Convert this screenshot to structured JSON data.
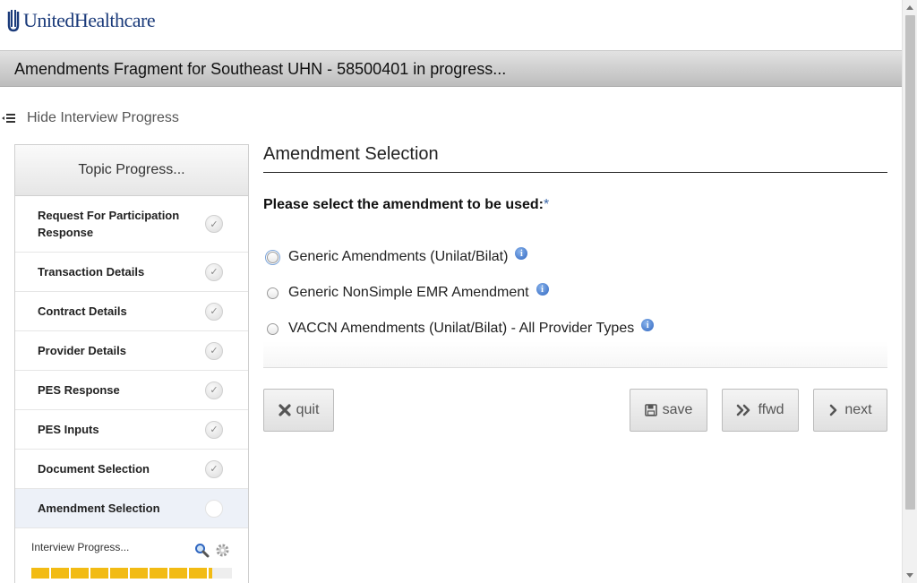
{
  "brand": {
    "logo_text": "UnitedHealthcare"
  },
  "header": {
    "title": "Amendments Fragment for Southeast UHN - 58500401 in progress..."
  },
  "sidebar_toggle": {
    "label": "Hide Interview Progress",
    "icon": "hamburger-collapse-icon"
  },
  "sidebar": {
    "title": "Topic Progress...",
    "topics": [
      {
        "label": "Request For Participation Response",
        "status": "complete"
      },
      {
        "label": "Transaction Details",
        "status": "complete"
      },
      {
        "label": "Contract Details",
        "status": "complete"
      },
      {
        "label": "Provider Details",
        "status": "complete"
      },
      {
        "label": "PES Response",
        "status": "complete"
      },
      {
        "label": "PES Inputs",
        "status": "complete"
      },
      {
        "label": "Document Selection",
        "status": "complete"
      },
      {
        "label": "Amendment Selection",
        "status": "current"
      }
    ],
    "interview_progress": {
      "label": "Interview Progress...",
      "progress_fraction": 0.9
    }
  },
  "main": {
    "title": "Amendment Selection",
    "question": "Please select the amendment to be used:",
    "required_marker": "*",
    "options": [
      {
        "label": "Generic Amendments (Unilat/Bilat)",
        "selected": false
      },
      {
        "label": "Generic NonSimple EMR Amendment",
        "selected": false
      },
      {
        "label": "VACCN Amendments (Unilat/Bilat) - All Provider Types",
        "selected": false
      }
    ]
  },
  "buttons": {
    "quit": "quit",
    "save": "save",
    "ffwd": "ffwd",
    "next": "next"
  },
  "colors": {
    "brand_blue": "#1a3a7a",
    "progress_yellow": "#f2bb14",
    "info_blue": "#2f66c0",
    "active_topic_bg": "#edf1f8"
  }
}
